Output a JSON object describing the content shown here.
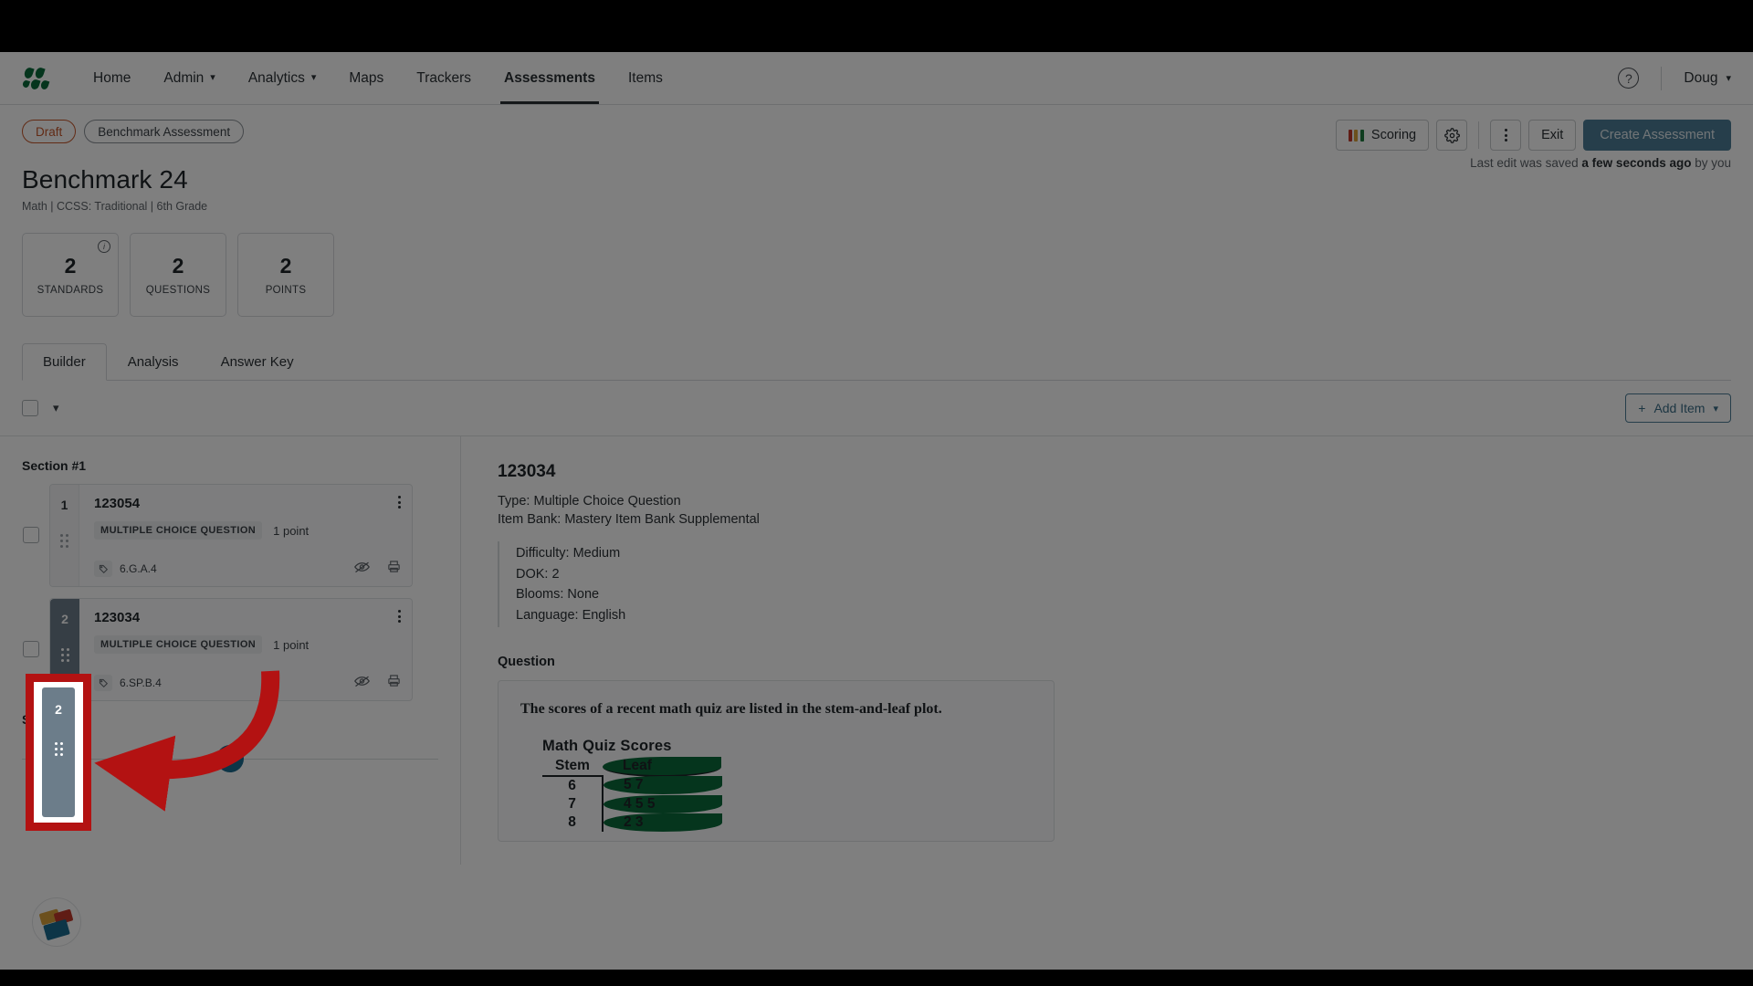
{
  "nav": {
    "logo_name": "mastery-logo",
    "items": [
      {
        "label": "Home",
        "has_caret": false,
        "active": false
      },
      {
        "label": "Admin",
        "has_caret": true,
        "active": false
      },
      {
        "label": "Analytics",
        "has_caret": true,
        "active": false
      },
      {
        "label": "Maps",
        "has_caret": false,
        "active": false
      },
      {
        "label": "Trackers",
        "has_caret": false,
        "active": false
      },
      {
        "label": "Assessments",
        "has_caret": false,
        "active": true
      },
      {
        "label": "Items",
        "has_caret": false,
        "active": false
      }
    ],
    "help_icon": "question-mark",
    "user": "Doug",
    "user_caret": "⌄"
  },
  "toolbar": {
    "status_badge": "Draft",
    "type_badge": "Benchmark Assessment",
    "scoring_label": "Scoring",
    "scoring_colors": [
      "#c0392b",
      "#d8a13a",
      "#1f7a3f"
    ],
    "settings_icon": "gear-icon",
    "more_icon": "kebab-menu-icon",
    "exit_label": "Exit",
    "create_label": "Create Assessment",
    "saved_prefix": "Last edit was saved ",
    "saved_strong": "a few seconds ago",
    "saved_suffix": " by you"
  },
  "header": {
    "title": "Benchmark 24",
    "subtitle": "Math  |  CCSS: Traditional  |  6th Grade"
  },
  "stats": [
    {
      "value": "2",
      "label": "STANDARDS",
      "info": true
    },
    {
      "value": "2",
      "label": "QUESTIONS",
      "info": false
    },
    {
      "value": "2",
      "label": "POINTS",
      "info": false
    }
  ],
  "tabs": [
    {
      "label": "Builder",
      "active": true
    },
    {
      "label": "Analysis",
      "active": false
    },
    {
      "label": "Answer Key",
      "active": false
    }
  ],
  "builder_bar": {
    "select_all_name": "select-all-checkbox",
    "collapse_caret": "⌄",
    "add_item_plus": "+",
    "add_item_label": "Add Item",
    "add_item_caret": "⌄"
  },
  "sections": [
    {
      "title": "Section #1",
      "items": [
        {
          "number": "1",
          "id": "123054",
          "type_badge": "MULTIPLE CHOICE QUESTION",
          "points": "1 point",
          "standard": "6.G.A.4",
          "highlighted": false
        },
        {
          "number": "2",
          "id": "123034",
          "type_badge": "MULTIPLE CHOICE QUESTION",
          "points": "1 point",
          "standard": "6.SP.B.4",
          "highlighted": true
        }
      ]
    },
    {
      "title": "Section #2",
      "items": []
    }
  ],
  "detail": {
    "id": "123034",
    "type_line": "Type: Multiple Choice Question",
    "bank_line": "Item Bank: Mastery Item Bank Supplemental",
    "meta": [
      "Difficulty: Medium",
      "DOK: 2",
      "Blooms: None",
      "Language: English"
    ],
    "question_heading": "Question",
    "question_text": "The scores of a recent math quiz are listed in the stem-and-leaf plot.",
    "plot": {
      "title": "Math Quiz Scores",
      "stem_header": "Stem",
      "leaf_header": "Leaf",
      "rows": [
        {
          "stem": "6",
          "leaf": "5 7"
        },
        {
          "stem": "7",
          "leaf": "4 5 5"
        },
        {
          "stem": "8",
          "leaf": "2 3"
        }
      ]
    }
  },
  "annotation": {
    "rect_color": "#b31212",
    "arrow_color": "#b31212",
    "target": "drag-handle-item-2"
  },
  "help_widget": {
    "name": "support-chat-widget"
  }
}
